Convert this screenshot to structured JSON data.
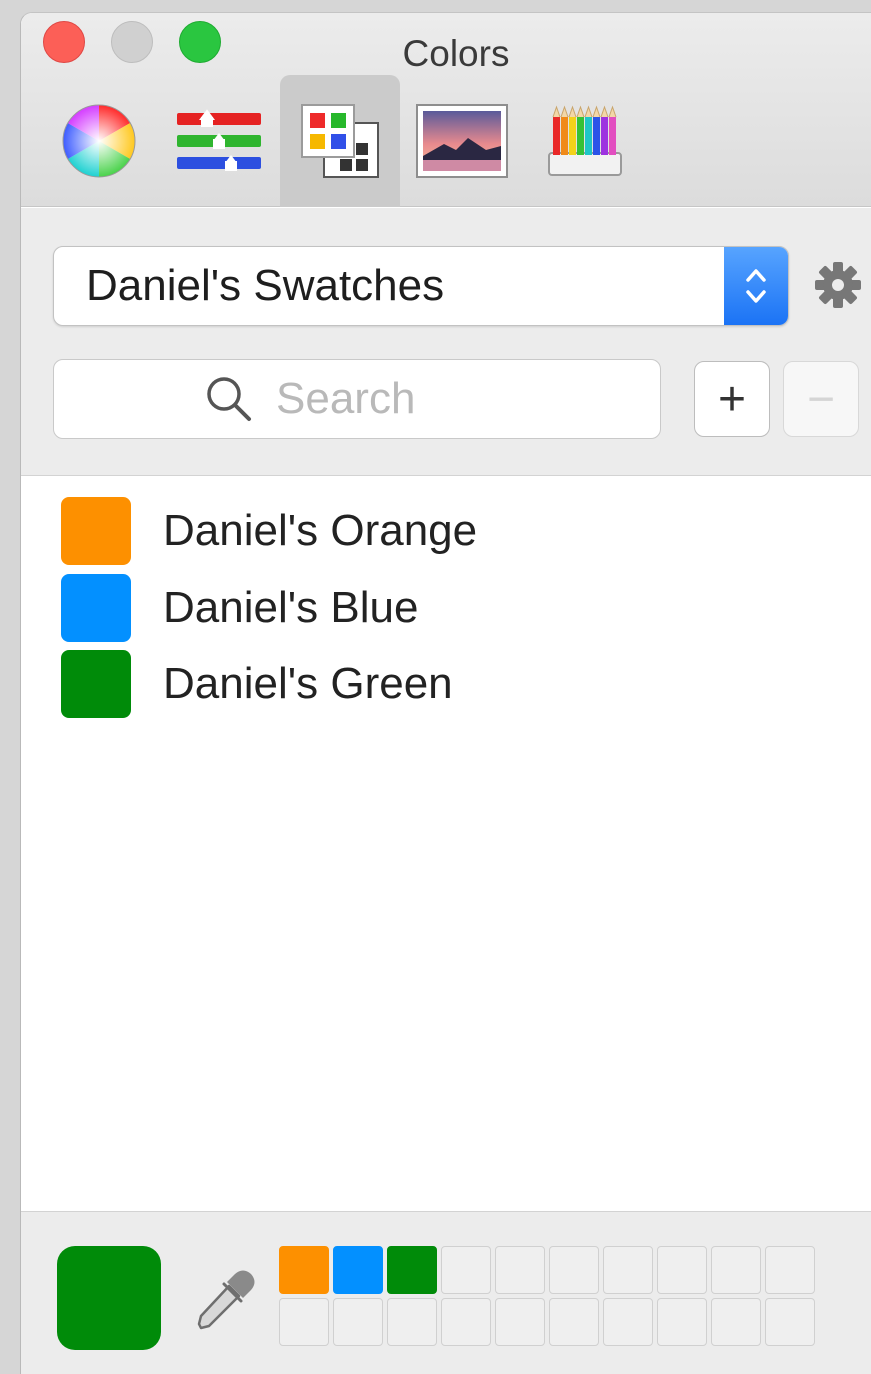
{
  "window": {
    "title": "Colors"
  },
  "toolbar": {
    "tools": [
      {
        "name": "color-wheel",
        "icon": "color-wheel-icon",
        "selected": false
      },
      {
        "name": "color-sliders",
        "icon": "sliders-icon",
        "selected": false
      },
      {
        "name": "color-palettes",
        "icon": "palette-icon",
        "selected": true
      },
      {
        "name": "image-palettes",
        "icon": "image-icon",
        "selected": false
      },
      {
        "name": "pencils",
        "icon": "pencils-icon",
        "selected": false
      }
    ]
  },
  "palette_selector": {
    "value": "Daniel's Swatches",
    "gear_icon": "gear-icon"
  },
  "search": {
    "placeholder": "Search"
  },
  "buttons": {
    "add": "+",
    "remove": "−"
  },
  "swatches": [
    {
      "label": "Daniel's Orange",
      "color": "#fd9000"
    },
    {
      "label": "Daniel's Blue",
      "color": "#0390ff"
    },
    {
      "label": "Daniel's Green",
      "color": "#008b09"
    }
  ],
  "footer": {
    "current_color": "#008b09",
    "favorites": [
      "#fd9000",
      "#0390ff",
      "#008b09"
    ]
  },
  "colors": {
    "accent": "#1b73f5",
    "toolbar_bg": "#dcdcdc"
  }
}
